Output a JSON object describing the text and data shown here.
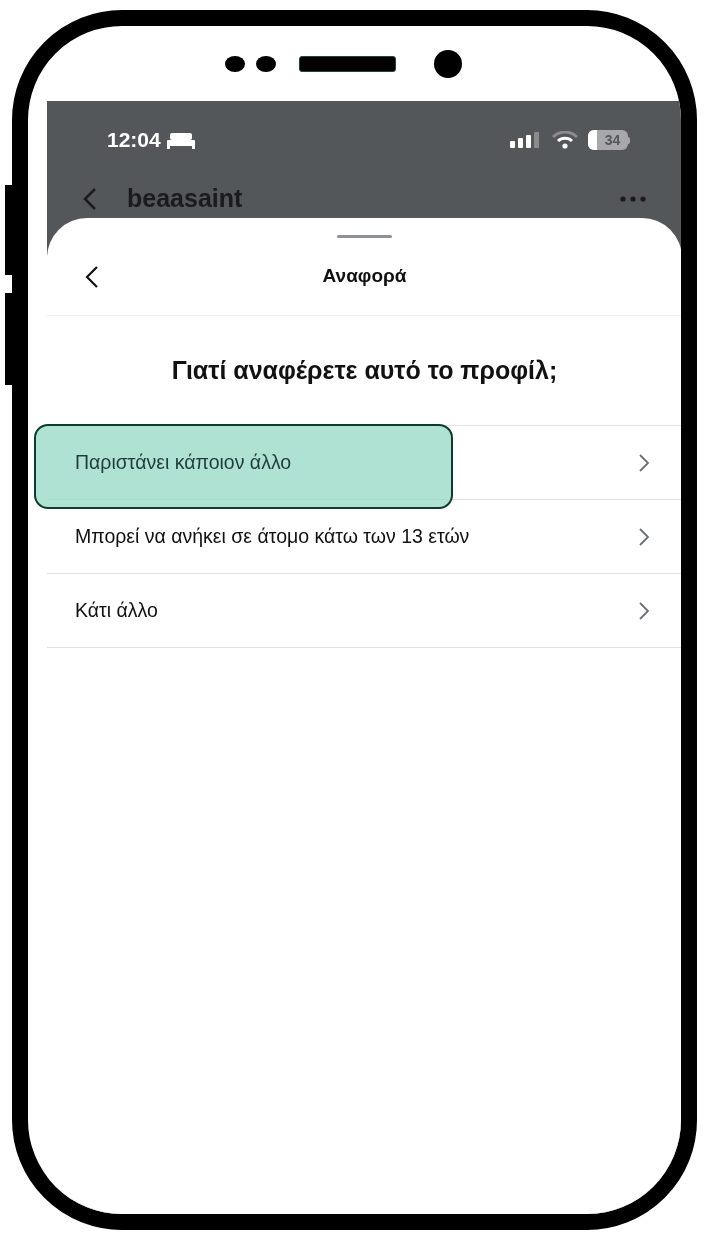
{
  "status_bar": {
    "time": "12:04",
    "battery": "34"
  },
  "nav": {
    "username": "beaasaint"
  },
  "sheet": {
    "title": "Αναφορά",
    "heading": "Γιατί αναφέρετε αυτό το προφίλ;"
  },
  "options": [
    {
      "label": "Παριστάνει κάποιον άλλο",
      "highlighted": true
    },
    {
      "label": "Μπορεί να ανήκει σε άτομο κάτω των 13 ετών",
      "highlighted": false
    },
    {
      "label": "Κάτι άλλο",
      "highlighted": false
    }
  ]
}
